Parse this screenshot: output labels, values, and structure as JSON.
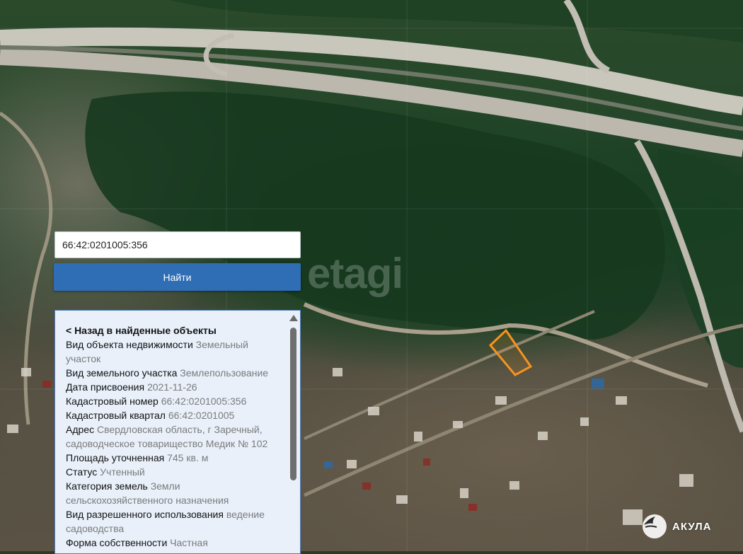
{
  "search": {
    "value": "66:42:0201005:356",
    "button_label": "Найти"
  },
  "panel": {
    "back_label": "< Назад в найденные объекты",
    "rows": [
      {
        "label": "Вид объекта недвижимости",
        "value": "Земельный участок"
      },
      {
        "label": "Вид земельного участка",
        "value": "Землепользование"
      },
      {
        "label": "Дата присвоения",
        "value": "2021-11-26"
      },
      {
        "label": "Кадастровый номер",
        "value": "66:42:0201005:356"
      },
      {
        "label": "Кадастровый квартал",
        "value": "66:42:0201005"
      },
      {
        "label": "Адрес",
        "value": "Свердловская область, г Заречный, садоводческое товарищество Медик № 102"
      },
      {
        "label": "Площадь уточненная",
        "value": "745 кв. м"
      },
      {
        "label": "Статус",
        "value": "Учтенный"
      },
      {
        "label": "Категория земель",
        "value": "Земли сельскохозяйственного назначения"
      },
      {
        "label": "Вид разрешенного использования",
        "value": "ведение садоводства"
      },
      {
        "label": "Форма собственности",
        "value": "Частная"
      }
    ]
  },
  "map": {
    "watermark": "etagi",
    "logo_text": "АКУЛА",
    "parcel_color": "#f7931e"
  }
}
